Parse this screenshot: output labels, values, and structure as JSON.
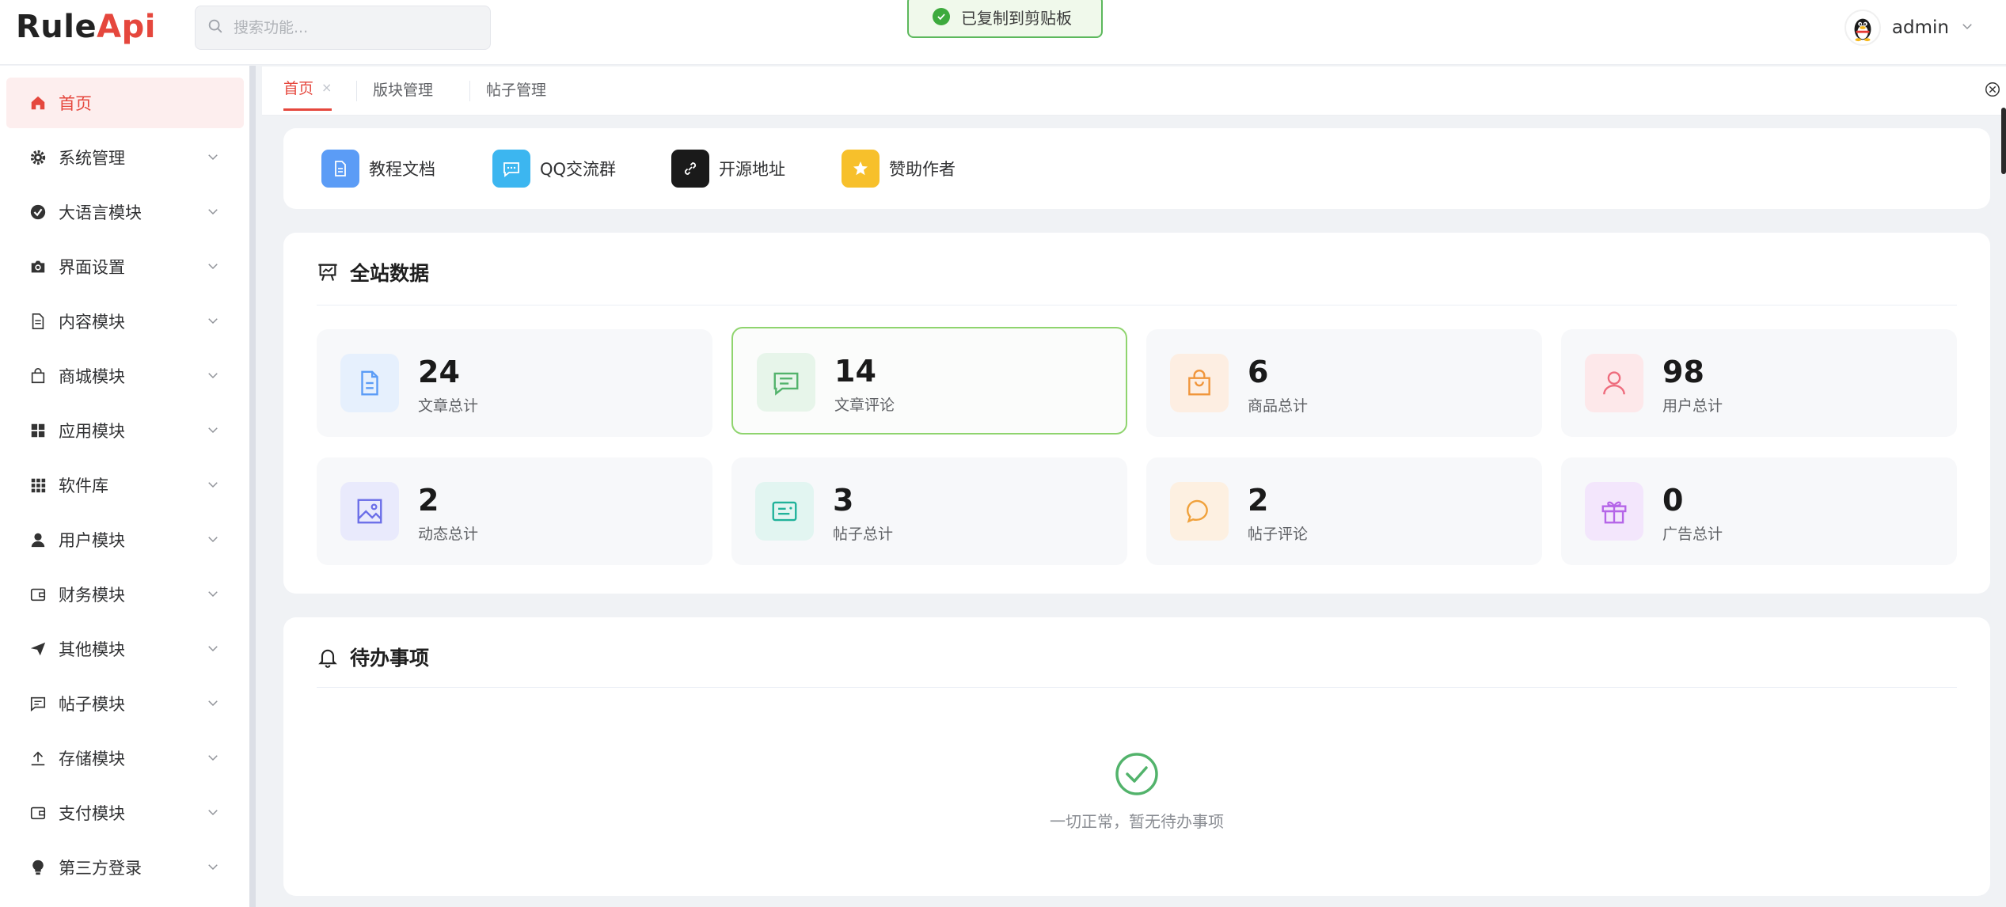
{
  "app": {
    "logo_part1": "Rule",
    "logo_part2": "Api",
    "search_placeholder": "搜索功能...",
    "username": "admin",
    "toast": "已复制到剪贴板"
  },
  "sidebar": {
    "items": [
      {
        "label": "首页",
        "icon": "home-icon",
        "active": true
      },
      {
        "label": "系统管理",
        "icon": "gear-icon"
      },
      {
        "label": "大语言模块",
        "icon": "check-circle-icon"
      },
      {
        "label": "界面设置",
        "icon": "camera-icon"
      },
      {
        "label": "内容模块",
        "icon": "document-icon"
      },
      {
        "label": "商城模块",
        "icon": "shopping-bag-icon"
      },
      {
        "label": "应用模块",
        "icon": "grid-icon"
      },
      {
        "label": "软件库",
        "icon": "apps-icon"
      },
      {
        "label": "用户模块",
        "icon": "user-icon"
      },
      {
        "label": "财务模块",
        "icon": "wallet-icon"
      },
      {
        "label": "其他模块",
        "icon": "send-icon"
      },
      {
        "label": "帖子模块",
        "icon": "message-icon"
      },
      {
        "label": "存储模块",
        "icon": "upload-icon"
      },
      {
        "label": "支付模块",
        "icon": "wallet-icon"
      },
      {
        "label": "第三方登录",
        "icon": "bulb-icon"
      }
    ]
  },
  "tabs": [
    {
      "label": "首页",
      "active": true,
      "close": "×"
    },
    {
      "label": "版块管理"
    },
    {
      "label": "帖子管理"
    }
  ],
  "quick_links": [
    {
      "label": "教程文档",
      "icon": "doc-icon",
      "color": "#5b9cf6"
    },
    {
      "label": "QQ交流群",
      "icon": "chat-icon",
      "color": "#3cb6f0"
    },
    {
      "label": "开源地址",
      "icon": "link-icon",
      "color": "#1a1a1a"
    },
    {
      "label": "赞助作者",
      "icon": "star-icon",
      "color": "#f7c02b"
    }
  ],
  "stats_section": {
    "title": "全站数据",
    "items": [
      {
        "value": "24",
        "label": "文章总计",
        "icon": "document-icon",
        "color": "#5b9cf6",
        "bg": "#e6f0fd"
      },
      {
        "value": "14",
        "label": "文章评论",
        "icon": "message-icon",
        "color": "#52b36b",
        "bg": "#e7f5ea",
        "highlighted": true
      },
      {
        "value": "6",
        "label": "商品总计",
        "icon": "shopping-bag-icon",
        "color": "#f0953b",
        "bg": "#fdeee2"
      },
      {
        "value": "98",
        "label": "用户总计",
        "icon": "user-icon",
        "color": "#ee6c7d",
        "bg": "#fde8ea"
      },
      {
        "value": "2",
        "label": "动态总计",
        "icon": "image-icon",
        "color": "#6b6ee8",
        "bg": "#e9eafc"
      },
      {
        "value": "3",
        "label": "帖子总计",
        "icon": "card-icon",
        "color": "#20b29a",
        "bg": "#e2f5f1"
      },
      {
        "value": "2",
        "label": "帖子评论",
        "icon": "chat-bubble-icon",
        "color": "#f0a13b",
        "bg": "#fdf0e1"
      },
      {
        "value": "0",
        "label": "广告总计",
        "icon": "gift-icon",
        "color": "#b565e8",
        "bg": "#f3e6fc"
      }
    ]
  },
  "todo_section": {
    "title": "待办事项",
    "empty_text": "一切正常，暂无待办事项"
  }
}
